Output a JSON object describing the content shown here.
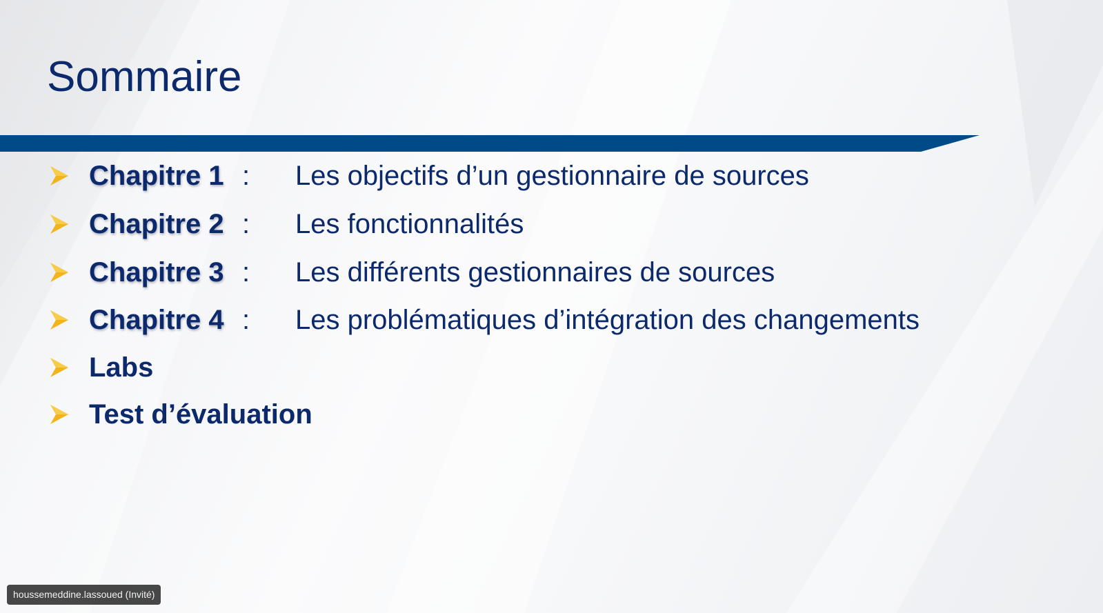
{
  "slide": {
    "title": "Sommaire",
    "colors": {
      "title": "#0c2a6b",
      "band": "#004a87",
      "bullet": "#f2b31b",
      "background": "#f5f6f8"
    },
    "items": [
      {
        "label": "Chapitre 1",
        "colon": ":",
        "desc": "Les objectifs d’un gestionnaire de sources",
        "icon": "arrow-bullet-icon"
      },
      {
        "label": "Chapitre 2",
        "colon": ":",
        "desc": "Les fonctionnalités",
        "icon": "arrow-bullet-icon"
      },
      {
        "label": "Chapitre 3",
        "colon": ":",
        "desc": "Les différents gestionnaires de sources",
        "icon": "arrow-bullet-icon"
      },
      {
        "label": "Chapitre 4",
        "colon": ":",
        "desc": "Les problématiques d’intégration des changements",
        "icon": "arrow-bullet-icon"
      },
      {
        "label": "Labs",
        "icon": "arrow-bullet-icon"
      },
      {
        "label": "Test d’évaluation",
        "icon": "arrow-bullet-icon"
      }
    ]
  },
  "participant": {
    "name": "houssemeddine.lassoued (Invité)"
  }
}
